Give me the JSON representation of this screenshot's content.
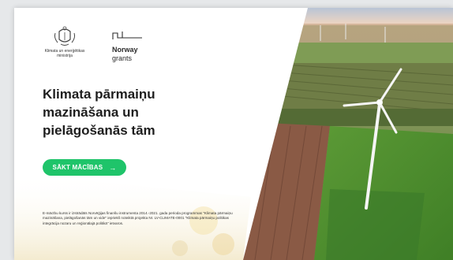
{
  "ministry": {
    "name": "Klimata un enerģētikas ministrija"
  },
  "norway": {
    "line1": "Norway",
    "line2": "grants"
  },
  "hero": {
    "title_line1": "Klimata pārmaiņu",
    "title_line2": "mazināšana un",
    "title_line3": "pielāgošanās tām"
  },
  "start_button": {
    "label": "SĀKT MĀCĪBAS",
    "arrow": "→"
  },
  "footnote": {
    "text": "E-mācību kurss ir izstrādāts Norvēģijas finanšu instrumenta 2014.-2021. gada perioda programmas \"Klimata pārmaiņu mazināšana, pielāgošanās tām un vide\" iepriekš noteiktā projekta Nr. LV-CLIMATE-0001 \"Klimata pārmaiņu politikas integrācija nozaru un reģionālajā politikā\" ietvaros."
  },
  "colors": {
    "accent": "#1fc46a",
    "text": "#1e1e1e"
  }
}
